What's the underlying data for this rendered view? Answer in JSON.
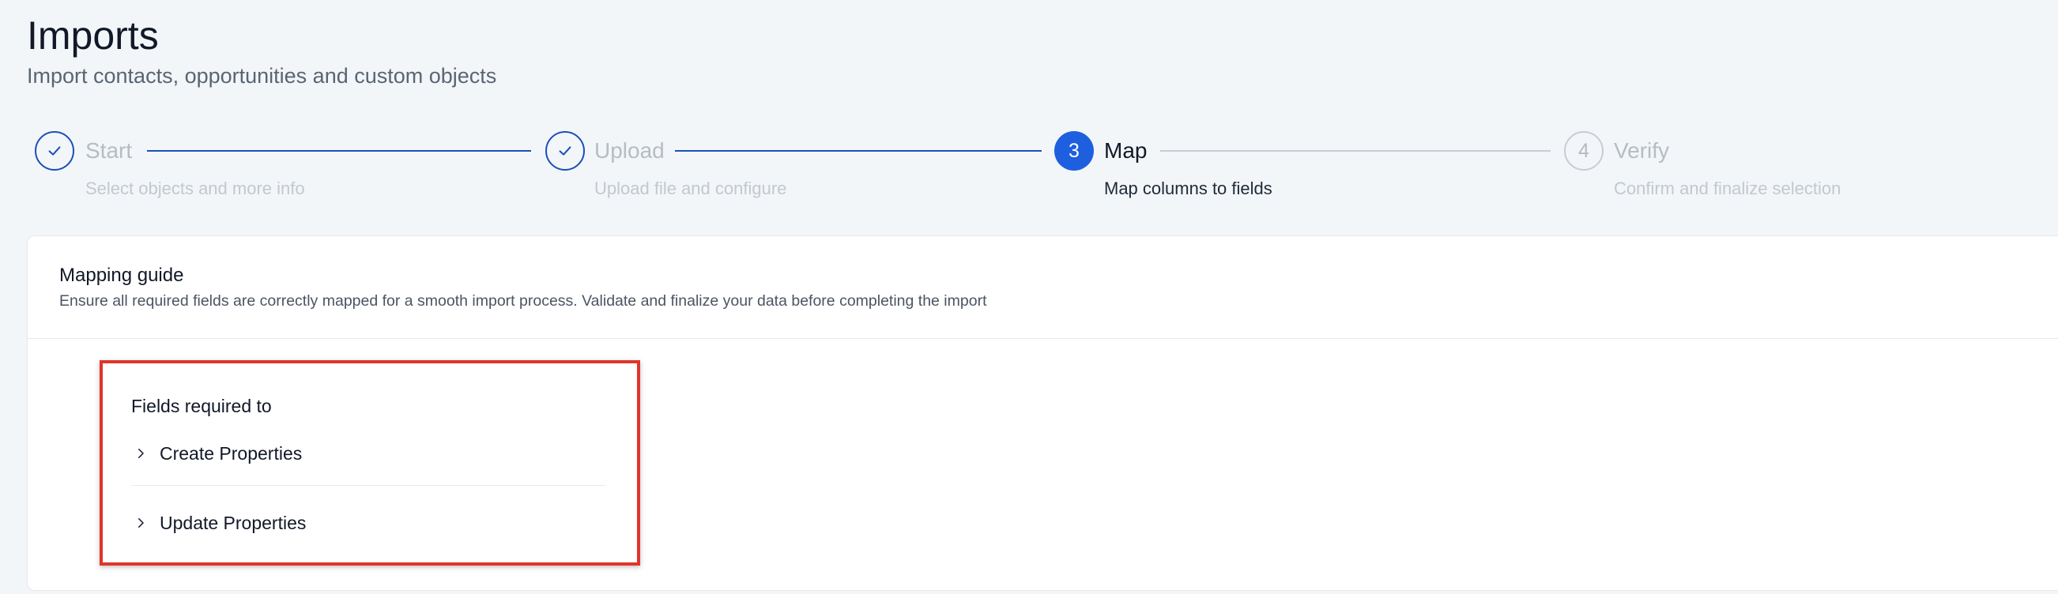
{
  "page": {
    "title": "Imports",
    "subtitle": "Import contacts, opportunities and custom objects"
  },
  "stepper": {
    "steps": [
      {
        "number": "",
        "title": "Start",
        "description": "Select objects and more info",
        "state": "completed"
      },
      {
        "number": "",
        "title": "Upload",
        "description": "Upload file and configure",
        "state": "completed"
      },
      {
        "number": "3",
        "title": "Map",
        "description": "Map columns to fields",
        "state": "active"
      },
      {
        "number": "4",
        "title": "Verify",
        "description": "Confirm and finalize selection",
        "state": "pending"
      }
    ]
  },
  "mapping_guide": {
    "title": "Mapping guide",
    "description": "Ensure all required fields are correctly mapped for a smooth import process. Validate and finalize your data before completing the import"
  },
  "required_fields": {
    "title": "Fields required to",
    "items": [
      {
        "label": "Create Properties",
        "icon": "chevron-right-icon"
      },
      {
        "label": "Update Properties",
        "icon": "chevron-right-icon"
      }
    ]
  },
  "colors": {
    "accent": "#1e5fe0",
    "completed": "#1a4fb8",
    "pending": "#c8ccd3",
    "highlight": "#e0342a"
  }
}
